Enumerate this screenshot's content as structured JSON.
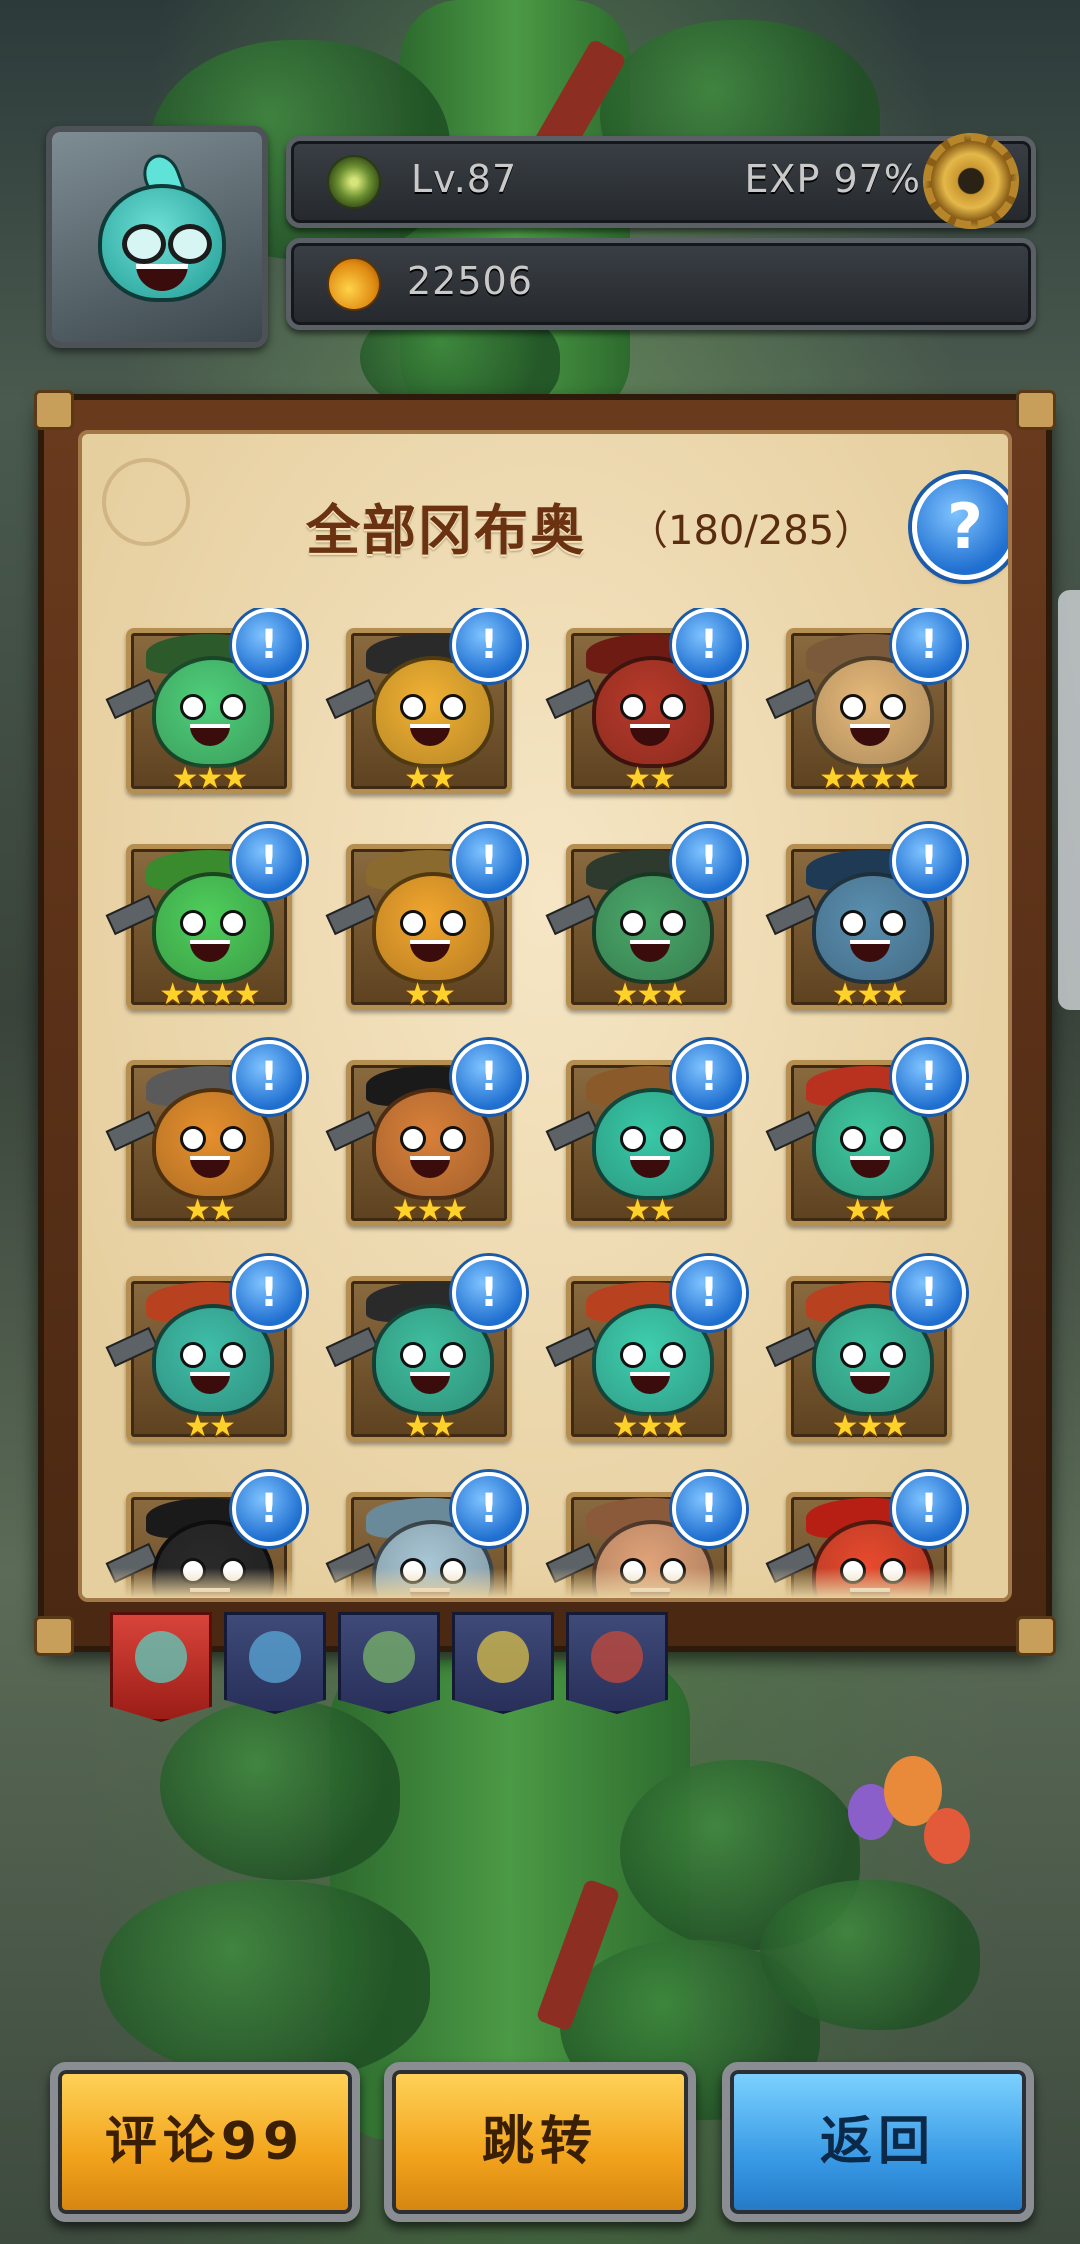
{
  "hud": {
    "level_text": "Lv.87",
    "exp_text": "EXP 97%",
    "coins_text": "22506",
    "settings_icon": "gear-icon",
    "level_icon": "clover-icon",
    "coins_icon": "fruit-icon"
  },
  "panel": {
    "title": "全部冈布奥",
    "count": "（180/285）",
    "help_label": "?",
    "info_label": "!"
  },
  "heroes": [
    {
      "stars": "★★★",
      "color": "#4fd07a",
      "hat": "#2d5a2a"
    },
    {
      "stars": "★★",
      "color": "#f2b233",
      "hat": "#2a2a2a"
    },
    {
      "stars": "★★",
      "color": "#b83a2a",
      "hat": "#6e1c13"
    },
    {
      "stars": "★★★★",
      "color": "#e6b97a",
      "hat": "#7a5a3a"
    },
    {
      "stars": "★★★★",
      "color": "#4fcf5c",
      "hat": "#3a8a2e"
    },
    {
      "stars": "★★",
      "color": "#f2a62e",
      "hat": "#8a6a2f"
    },
    {
      "stars": "★★★",
      "color": "#4aa86a",
      "hat": "#2e3a2e"
    },
    {
      "stars": "★★★",
      "color": "#5a8fb0",
      "hat": "#1f3a55"
    },
    {
      "stars": "★★",
      "color": "#e6902e",
      "hat": "#5a5a5a"
    },
    {
      "stars": "★★★",
      "color": "#d9803a",
      "hat": "#1a1a1a"
    },
    {
      "stars": "★★",
      "color": "#39c9a8",
      "hat": "#8a5a2a"
    },
    {
      "stars": "★★",
      "color": "#3fc8a0",
      "hat": "#b8321f"
    },
    {
      "stars": "★★",
      "color": "#3fbfa9",
      "hat": "#b8421f"
    },
    {
      "stars": "★★",
      "color": "#3fbfa0",
      "hat": "#2a2a2a"
    },
    {
      "stars": "★★★",
      "color": "#3fcfb0",
      "hat": "#b8421f"
    },
    {
      "stars": "★★★",
      "color": "#3fbf9f",
      "hat": "#b8421f"
    },
    {
      "stars": "",
      "color": "#2a2a2a",
      "hat": "#1a1a1a"
    },
    {
      "stars": "",
      "color": "#a9c7d6",
      "hat": "#6b8a99"
    },
    {
      "stars": "",
      "color": "#e2a47a",
      "hat": "#8a5a3a"
    },
    {
      "stars": "",
      "color": "#e84a2e",
      "hat": "#b81f14"
    }
  ],
  "tabs": [
    {
      "name": "all",
      "color": "#5acfc0",
      "active": true
    },
    {
      "name": "blue",
      "color": "#5aa8d8",
      "active": false
    },
    {
      "name": "green",
      "color": "#7ab56a",
      "active": false
    },
    {
      "name": "yellow",
      "color": "#d9c04a",
      "active": false
    },
    {
      "name": "red",
      "color": "#c84a3a",
      "active": false
    }
  ],
  "buttons": {
    "comment": "评论99",
    "jump": "跳转",
    "back": "返回"
  }
}
